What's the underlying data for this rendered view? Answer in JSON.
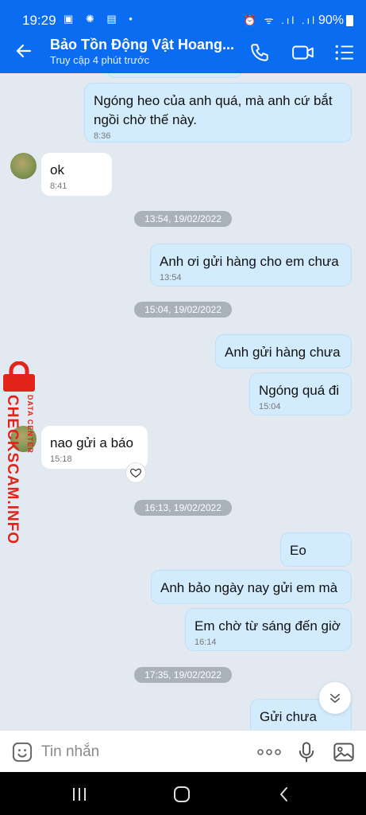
{
  "status_bar": {
    "time": "19:29",
    "left_icons": "▣ ✺ ▤ •",
    "right_icons": "⏰ ᯤ .ıl .ıl",
    "battery": "90%"
  },
  "header": {
    "title": "Bảo Tồn Động Vật Hoang...",
    "subtitle": "Truy cập 4 phút trước",
    "icons": [
      "back-arrow-icon",
      "phone-icon",
      "video-call-icon",
      "menu-list-icon"
    ]
  },
  "messages": [
    {
      "dir": "out",
      "text": "Ngóng heo của anh quá, mà anh cứ bắt ngồi chờ thế này.",
      "time": "8:36"
    },
    {
      "dir": "in",
      "text": "ok",
      "time": "8:41"
    },
    {
      "dir": "date",
      "text": "13:54, 19/02/2022"
    },
    {
      "dir": "out",
      "text": "Anh ơi gửi hàng cho em chưa",
      "time": "13:54"
    },
    {
      "dir": "date",
      "text": "15:04, 19/02/2022"
    },
    {
      "dir": "out",
      "text": "Anh gửi hàng chưa",
      "time": ""
    },
    {
      "dir": "out",
      "text": "Ngóng quá đi",
      "time": "15:04"
    },
    {
      "dir": "in",
      "text": "nao gửi a báo",
      "time": "15:18"
    },
    {
      "dir": "date",
      "text": "16:13, 19/02/2022"
    },
    {
      "dir": "out",
      "text": "Eo",
      "time": ""
    },
    {
      "dir": "out",
      "text": "Anh bảo ngày nay gửi em mà",
      "time": ""
    },
    {
      "dir": "out",
      "text": "Em chờ từ sáng đến giờ",
      "time": "16:14"
    },
    {
      "dir": "date",
      "text": "17:35, 19/02/2022"
    },
    {
      "dir": "out",
      "text": "Gửi chưa anh",
      "time": ""
    }
  ],
  "watermark": {
    "brand": "CHECKSCAM.INFO",
    "sub": "DATA CENTER",
    "color": "#e2231a"
  },
  "composer": {
    "placeholder": "Tin nhắn",
    "icons": [
      "emoji-icon",
      "more-icon",
      "microphone-icon",
      "image-icon"
    ]
  },
  "colors": {
    "accent": "#0a6cf0",
    "outgoing_bubble": "#d3ecfd",
    "incoming_bubble": "#ffffff",
    "background": "#e2e9f1"
  }
}
